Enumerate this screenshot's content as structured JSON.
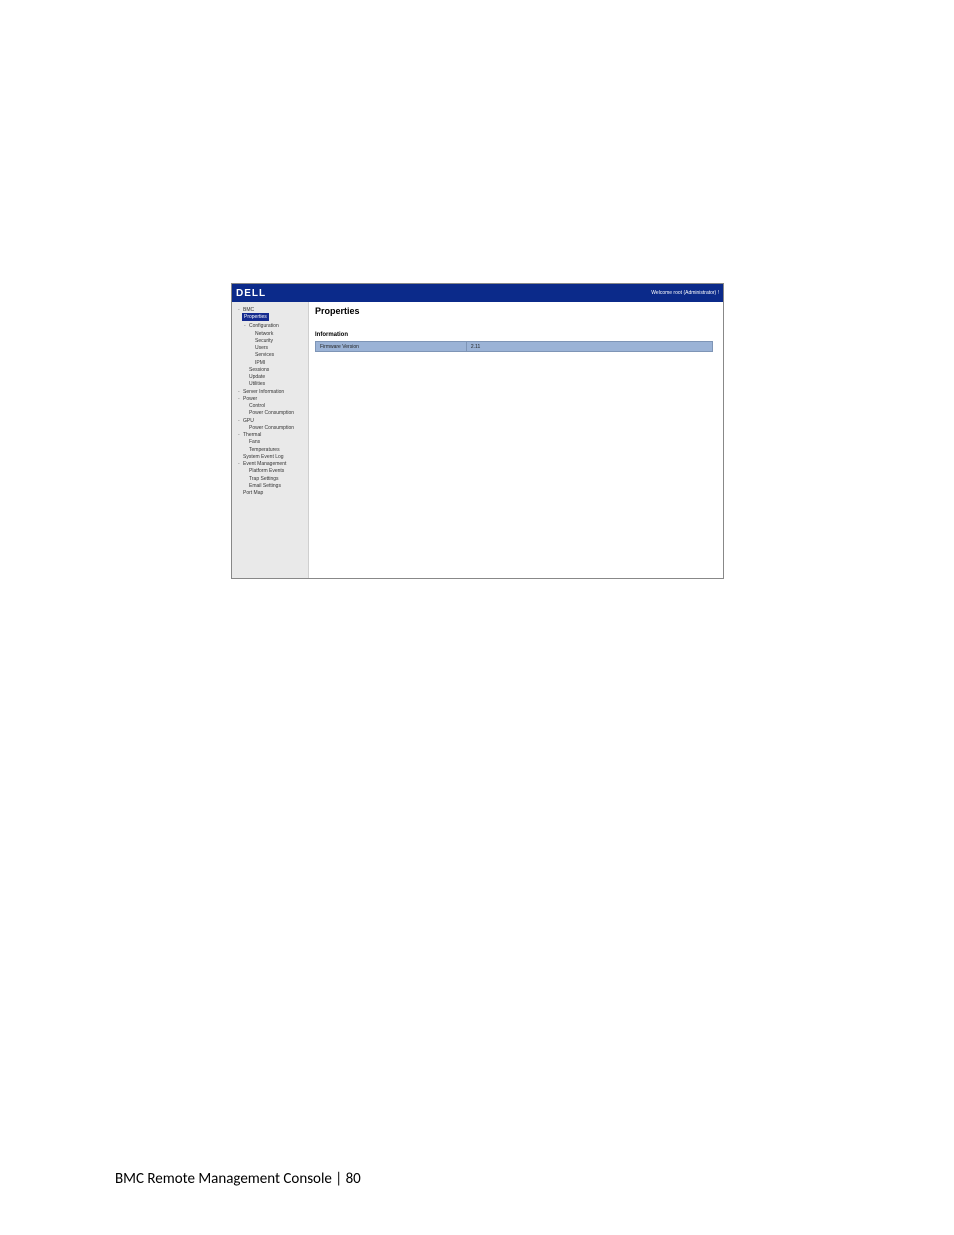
{
  "topbar": {
    "logo_text": "DELL",
    "welcome_text": "Welcome root (Administrator) !"
  },
  "sidebar": {
    "tree": [
      {
        "label": "BMC",
        "level": 0,
        "expander": "-",
        "selected": false
      },
      {
        "label": "Properties",
        "level": 1,
        "expander": "",
        "selected": true
      },
      {
        "label": "Configuration",
        "level": 1,
        "expander": "-",
        "selected": false
      },
      {
        "label": "Network",
        "level": 2,
        "expander": "",
        "selected": false
      },
      {
        "label": "Security",
        "level": 2,
        "expander": "",
        "selected": false
      },
      {
        "label": "Users",
        "level": 2,
        "expander": "",
        "selected": false
      },
      {
        "label": "Services",
        "level": 2,
        "expander": "",
        "selected": false
      },
      {
        "label": "IPMI",
        "level": 2,
        "expander": "",
        "selected": false
      },
      {
        "label": "Sessions",
        "level": 1,
        "expander": "",
        "selected": false
      },
      {
        "label": "Update",
        "level": 1,
        "expander": "",
        "selected": false
      },
      {
        "label": "Utilities",
        "level": 1,
        "expander": "",
        "selected": false
      },
      {
        "label": "Server Information",
        "level": 0,
        "expander": "-",
        "selected": false
      },
      {
        "label": "Power",
        "level": 0,
        "expander": "-",
        "selected": false
      },
      {
        "label": "Control",
        "level": 1,
        "expander": "",
        "selected": false
      },
      {
        "label": "Power Consumption",
        "level": 1,
        "expander": "",
        "selected": false
      },
      {
        "label": "GPU",
        "level": 0,
        "expander": "-",
        "selected": false
      },
      {
        "label": "Power Consumption",
        "level": 1,
        "expander": "",
        "selected": false
      },
      {
        "label": "Thermal",
        "level": 0,
        "expander": "-",
        "selected": false
      },
      {
        "label": "Fans",
        "level": 1,
        "expander": "",
        "selected": false
      },
      {
        "label": "Temperatures",
        "level": 1,
        "expander": "",
        "selected": false
      },
      {
        "label": "System Event Log",
        "level": 0,
        "expander": "",
        "selected": false
      },
      {
        "label": "Event Management",
        "level": 0,
        "expander": "-",
        "selected": false
      },
      {
        "label": "Platform Events",
        "level": 1,
        "expander": "",
        "selected": false
      },
      {
        "label": "Trap Settings",
        "level": 1,
        "expander": "",
        "selected": false
      },
      {
        "label": "Email Settings",
        "level": 1,
        "expander": "",
        "selected": false
      },
      {
        "label": "Port Map",
        "level": 0,
        "expander": "",
        "selected": false
      }
    ]
  },
  "content": {
    "title": "Properties",
    "section_label": "Information",
    "info_rows": [
      {
        "key": "Firmware Version",
        "value": "2.11"
      }
    ]
  },
  "page_footer": {
    "text": "BMC Remote Management Console | 80"
  }
}
